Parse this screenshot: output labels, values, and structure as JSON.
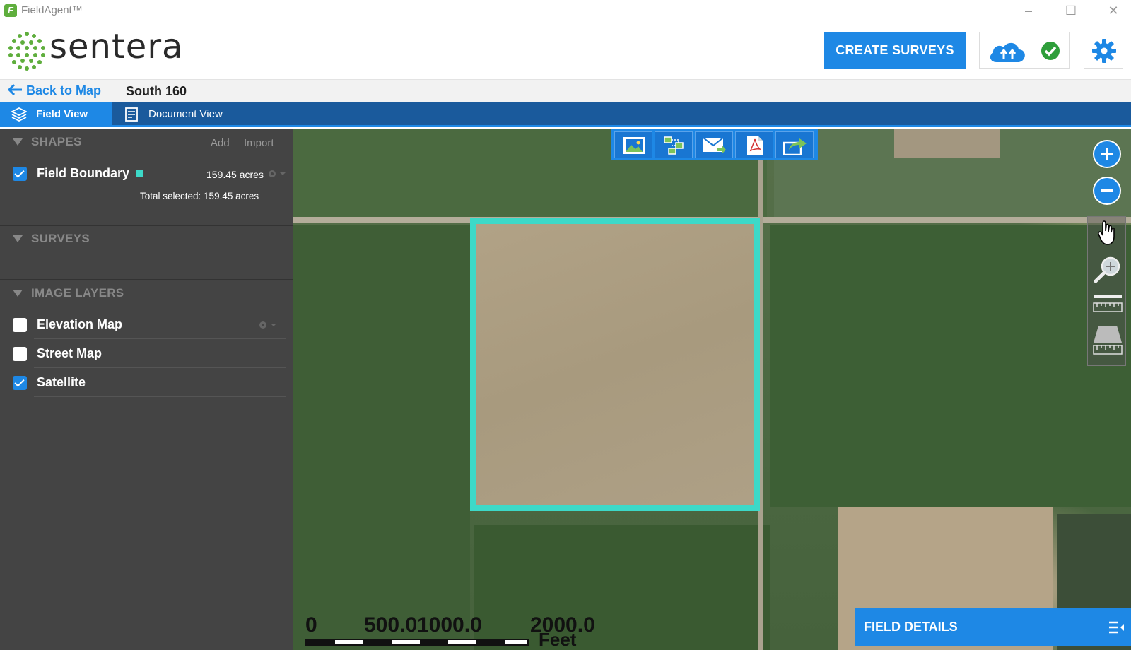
{
  "window": {
    "app_title": "FieldAgent™",
    "controls": {
      "minimize": "–",
      "maximize": "☐",
      "close": "✕"
    }
  },
  "header": {
    "logo_text": "sentera",
    "create_button": "CREATE SURVEYS",
    "brand_color": "#1e88e5",
    "icons": [
      "cloud-upload-icon",
      "check-circle-icon",
      "gear-icon"
    ]
  },
  "breadcrumb": {
    "back_label": "Back to Map",
    "title": "South 160"
  },
  "tabs": [
    {
      "label": "Field View",
      "active": true
    },
    {
      "label": "Document View",
      "active": false
    }
  ],
  "sidebar": {
    "shapes": {
      "title": "SHAPES",
      "add_label": "Add",
      "import_label": "Import",
      "items": [
        {
          "label": "Field Boundary",
          "checked": true,
          "color": "#3dd9c8",
          "acres": "159.45 acres"
        }
      ],
      "total_selected": "Total selected: 159.45 acres"
    },
    "surveys": {
      "title": "SURVEYS"
    },
    "image_layers": {
      "title": "IMAGE LAYERS",
      "items": [
        {
          "label": "Elevation Map",
          "checked": false
        },
        {
          "label": "Street Map",
          "checked": false
        },
        {
          "label": "Satellite",
          "checked": true
        }
      ]
    }
  },
  "map": {
    "toolbar_icons": [
      "image-export-icon",
      "tile-layout-icon",
      "email-icon",
      "pdf-icon",
      "share-icon"
    ],
    "boundary_color": "#3dd9c8",
    "scale": {
      "labels": [
        "0",
        "500.0",
        "1000.0",
        "2000.0"
      ],
      "unit": "Feet"
    },
    "field_details_label": "FIELD DETAILS"
  }
}
